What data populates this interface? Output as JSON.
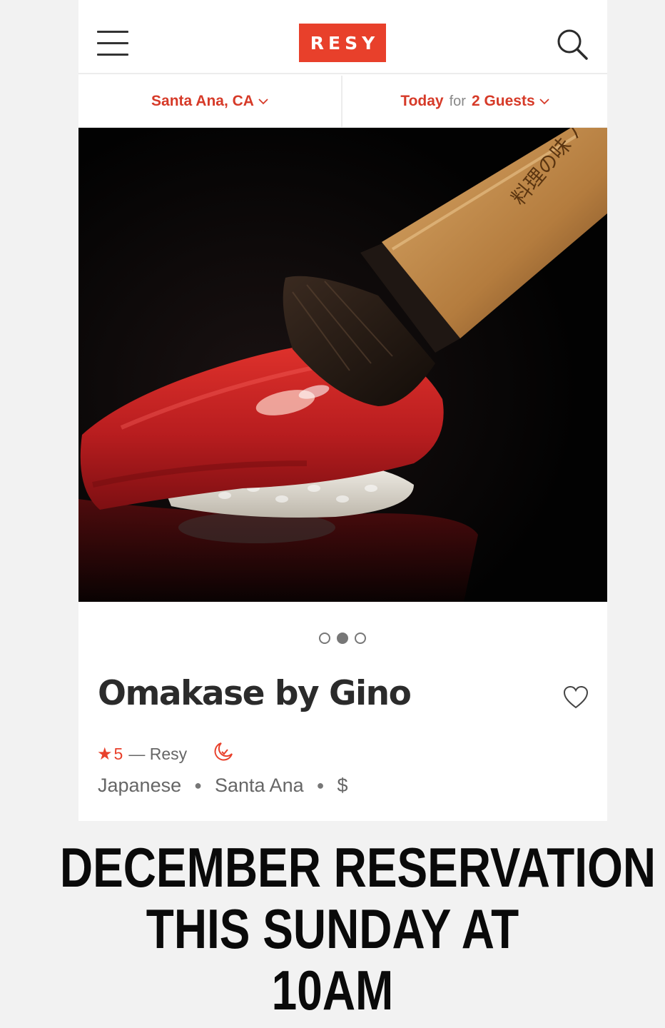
{
  "header": {
    "logo_text": "RESY"
  },
  "filters": {
    "location": "Santa Ana, CA",
    "date": "Today",
    "for_text": "for",
    "guests": "2 Guests"
  },
  "photo": {
    "brush_text": "料理の味 ハケ"
  },
  "carousel": {
    "total": 3,
    "active_index": 1
  },
  "restaurant": {
    "name": "Omakase by Gino",
    "rating": "5",
    "rating_source": "— Resy",
    "cuisine": "Japanese",
    "neighborhood": "Santa Ana",
    "price": "$"
  },
  "announcement": {
    "line1": "DECEMBER RESERVATION",
    "line2": "THIS SUNDAY AT",
    "line3": "10AM"
  },
  "colors": {
    "brand": "#e8402b",
    "filter_text": "#d63a28",
    "title": "#2b2b2b"
  },
  "icons": [
    "menu-icon",
    "search-icon",
    "chevron-down-icon",
    "heart-icon",
    "star-icon",
    "moon-icon"
  ]
}
